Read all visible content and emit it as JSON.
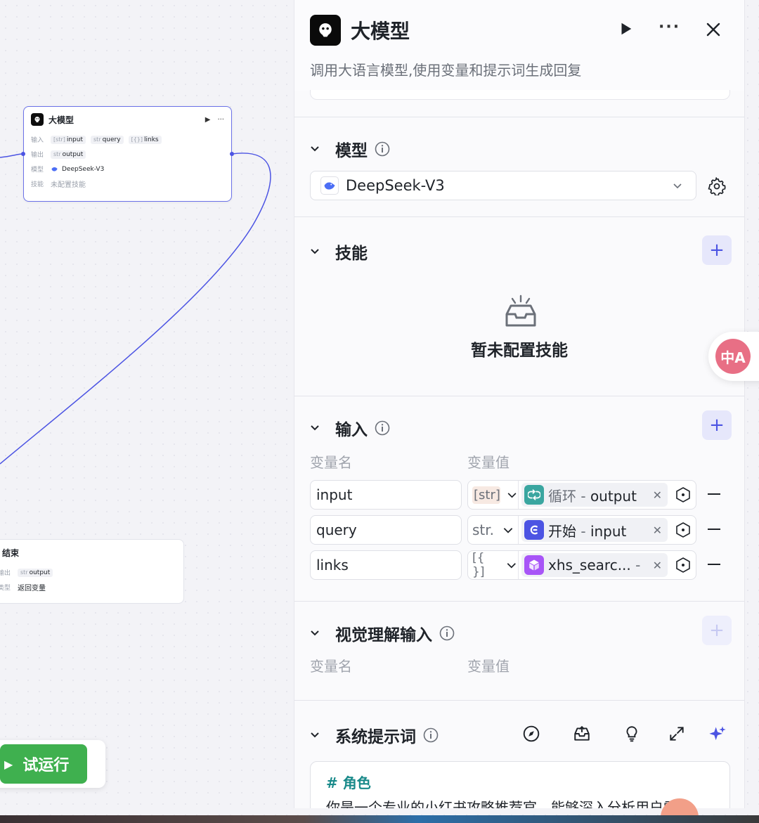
{
  "canvas": {
    "llm_node": {
      "title": "大模型",
      "rows": {
        "input_label": "输入",
        "inputs": [
          {
            "type": "[str]",
            "name": "input"
          },
          {
            "type": "str",
            "name": "query"
          },
          {
            "type": "[{}]",
            "name": "links"
          }
        ],
        "output_label": "输出",
        "outputs": [
          {
            "type": "str",
            "name": "output"
          }
        ],
        "model_label": "模型",
        "model_value": "DeepSeek-V3",
        "skill_label": "技能",
        "skill_value": "未配置技能"
      }
    },
    "end_node": {
      "title": "结束",
      "output_label": "输出",
      "output": {
        "type": "str",
        "name": "output"
      },
      "type_label": "类型",
      "type_value": "返回变量"
    },
    "run_button": {
      "label": "试运行"
    }
  },
  "panel": {
    "title": "大模型",
    "description": "调用大语言模型,使用变量和提示词生成回复",
    "model_section": {
      "title": "模型",
      "selected": "DeepSeek-V3"
    },
    "skills_section": {
      "title": "技能",
      "empty_text": "暂未配置技能"
    },
    "input_section": {
      "title": "输入",
      "col_name": "变量名",
      "col_value": "变量值",
      "rows": [
        {
          "name": "input",
          "type": "[str]",
          "ref_node": "循环",
          "ref_var": "output",
          "ref_color": "#3aa6a0"
        },
        {
          "name": "query",
          "type": "str.",
          "ref_node": "开始",
          "ref_var": "input",
          "ref_color": "#4c54e3"
        },
        {
          "name": "links",
          "type": "[{ }]",
          "ref_node": "xhs_searc...",
          "ref_var": "",
          "ref_color": "#a855f7"
        }
      ]
    },
    "vision_section": {
      "title": "视觉理解输入",
      "col_name": "变量名",
      "col_value": "变量值"
    },
    "system_prompt_section": {
      "title": "系统提示词",
      "heading": "# 角色",
      "text": "你是一个专业的小红书攻略推荐官，能够深入分析用户需"
    }
  },
  "translate_button": {
    "label": "中A"
  },
  "colors": {
    "accent": "#4c54e3",
    "run_green": "#3fb04f",
    "teal": "#3aa6a0",
    "purple": "#a855f7"
  }
}
